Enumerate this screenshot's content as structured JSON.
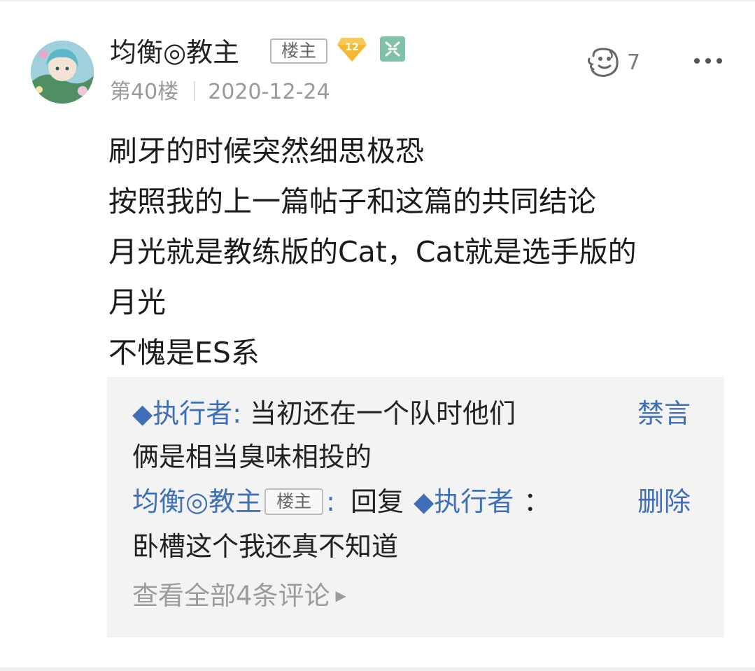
{
  "post": {
    "username": "均衡◎教主",
    "owner_label": "楼主",
    "level": "12",
    "floor": "第40楼",
    "date": "2020-12-24",
    "like_count": "7",
    "content": [
      "刷牙的时候突然细思极恐",
      "按照我的上一篇帖子和这篇的共同结论",
      "月光就是教练版的Cat，Cat就是选手版的",
      "月光",
      "不愧是ES系"
    ]
  },
  "comments": {
    "items": [
      {
        "user": "◆执行者:",
        "text_line1": "当初还在一个队时他们",
        "text_line2": "俩是相当臭味相投的",
        "action": "禁言"
      },
      {
        "user": "均衡◎教主",
        "owner_label": "楼主",
        "colon": ":",
        "reply_word": "回复",
        "reply_to": "◆执行者",
        "reply_colon": "：",
        "text_line2": "卧槽这个我还真不知道",
        "action": "删除"
      }
    ],
    "view_all": "查看全部4条评论"
  },
  "colors": {
    "link_blue": "#3e6fb7",
    "meta_gray": "#9a9a9a",
    "comment_bg": "#f3f3f3",
    "level_badge": "#f5b830"
  },
  "icons": [
    "avatar",
    "level-badge-icon",
    "member-icon",
    "like-icon",
    "more-icon",
    "chevron-right-icon"
  ]
}
